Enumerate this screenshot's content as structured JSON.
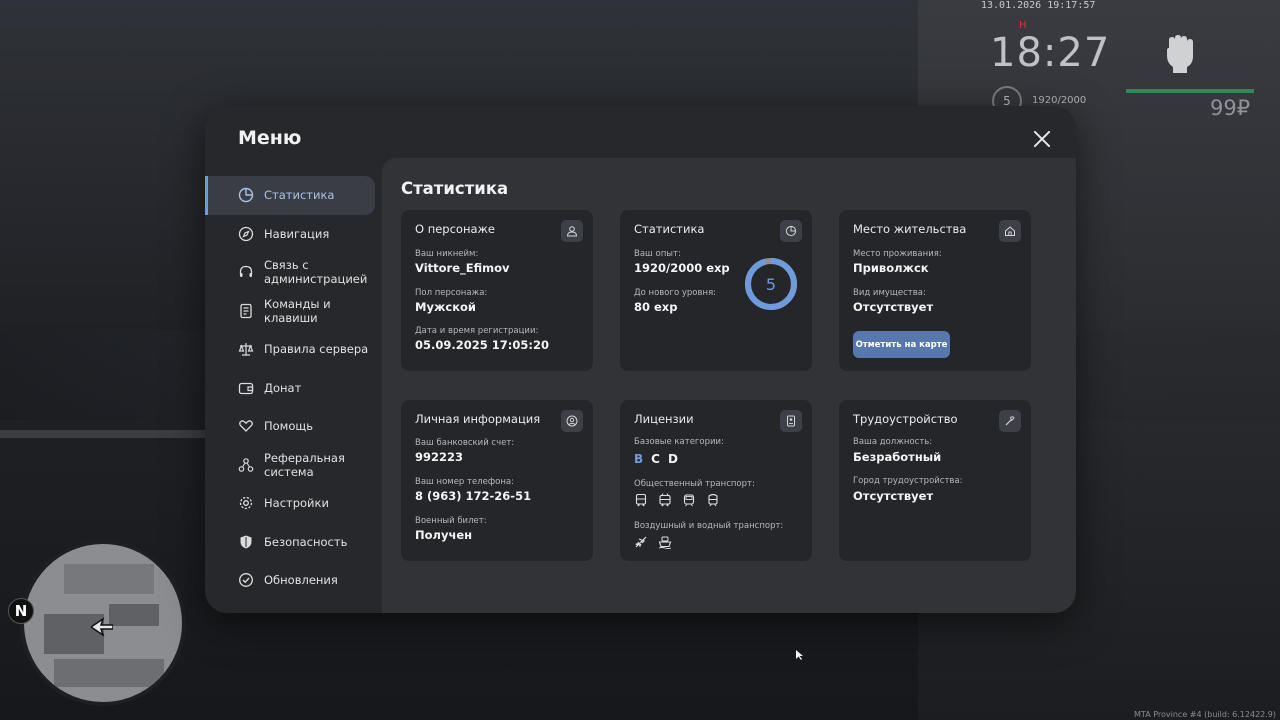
{
  "hud": {
    "datetime": "13.01.2026 19:17:57",
    "time": "18:27",
    "marker": "H",
    "level": "5",
    "exp": "1920/2000",
    "money": "99₽",
    "health_color": "#2f8a57"
  },
  "minimap": {
    "compass": "N"
  },
  "build_info": "MTA Province #4 (build: 6.12422.9)",
  "menu": {
    "title": "Меню",
    "close_icon": "close-icon",
    "nav": [
      {
        "label": "Статистика",
        "icon": "pie-chart-icon",
        "active": true
      },
      {
        "label": "Навигация",
        "icon": "compass-icon"
      },
      {
        "label": "Связь с администрацией",
        "icon": "headset-icon"
      },
      {
        "label": "Команды и клавиши",
        "icon": "document-icon"
      },
      {
        "label": "Правила сервера",
        "icon": "scales-icon"
      },
      {
        "label": "Донат",
        "icon": "wallet-icon"
      },
      {
        "label": "Помощь",
        "icon": "heart-hands-icon"
      },
      {
        "label": "Реферальная система",
        "icon": "network-icon"
      },
      {
        "label": "Настройки",
        "icon": "gear-icon"
      },
      {
        "label": "Безопасность",
        "icon": "shield-icon"
      },
      {
        "label": "Обновления",
        "icon": "check-circle-icon"
      }
    ]
  },
  "content": {
    "title": "Статистика",
    "character": {
      "title": "О персонаже",
      "nickname_label": "Ваш никнейм:",
      "nickname": "Vittore_Efimov",
      "gender_label": "Пол персонажа:",
      "gender": "Мужской",
      "reg_label": "Дата и время регистрации:",
      "reg": "05.09.2025 17:05:20"
    },
    "stats": {
      "title": "Статистика",
      "exp_label": "Ваш опыт:",
      "exp": "1920/2000 exp",
      "next_label": "До нового уровня:",
      "next": "80 exp",
      "level": "5",
      "progress": 0.96,
      "accent": "#6f9bdc"
    },
    "residence": {
      "title": "Место жительства",
      "place_label": "Место проживания:",
      "place": "Приволжск",
      "property_label": "Вид имущества:",
      "property": "Отсутствует",
      "map_button": "Отметить на карте"
    },
    "personal": {
      "title": "Личная информация",
      "bank_label": "Ваш банковский счет:",
      "bank": "992223",
      "phone_label": "Ваш номер телефона:",
      "phone": "8 (963) 172-26-51",
      "military_label": "Военный билет:",
      "military": "Получен"
    },
    "licenses": {
      "title": "Лицензии",
      "base_label": "Базовые категории:",
      "categories": [
        "B",
        "C",
        "D"
      ],
      "active_category": "B",
      "public_label": "Общественный транспорт:",
      "public_icons": [
        "bus-icon",
        "trolleybus-icon",
        "tram-icon",
        "metro-icon"
      ],
      "air_label": "Воздушный и водный транспорт:",
      "air_icons": [
        "plane-icon",
        "boat-icon"
      ]
    },
    "employment": {
      "title": "Трудоустройство",
      "position_label": "Ваша должность:",
      "position": "Безработный",
      "city_label": "Город трудоустройства:",
      "city": "Отсутствует"
    }
  }
}
